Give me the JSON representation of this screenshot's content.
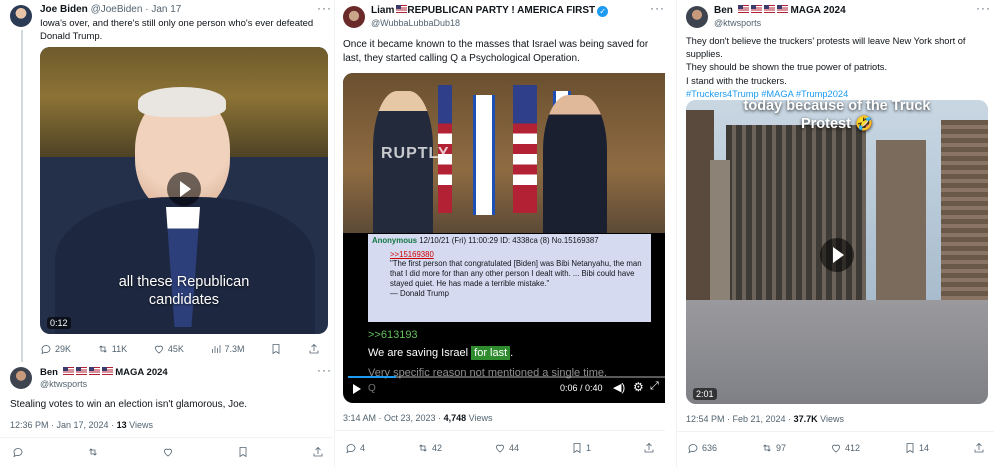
{
  "panel1": {
    "tweet": {
      "name": "Joe Biden",
      "handle": "@JoeBiden",
      "sep": "·",
      "date": "Jan 17",
      "text": "Iowa's over, and there's still only one person who's ever defeated Donald Trump.",
      "video_caption_line1": "all these Republican",
      "video_caption_line2": "candidates",
      "duration": "0:12",
      "stats": {
        "replies": "29K",
        "reposts": "11K",
        "likes": "45K",
        "views": "7.3M"
      }
    },
    "reply": {
      "name": "Ben",
      "handle": "@ktwsports",
      "maga": "MAGA 2024",
      "text": "Stealing votes to win an election isn't glamorous, Joe.",
      "time": "12:36 PM · Jan 17, 2024 ·",
      "views_count": "13",
      "views_label": "Views"
    }
  },
  "panel2": {
    "name": "Liam",
    "name_suffix": "REPUBLICAN PARTY ! AMERICA FIRST",
    "handle": "@WubbaLubbaDub18",
    "text": "Once it became known to the masses that Israel was being saved for last, they started calling Q a Psychological Operation.",
    "watermark": "RUPTLY",
    "post": {
      "author": "Anonymous",
      "date": "12/10/21 (Fri) 11:00:29",
      "id": "ID: 4338ca (8)",
      "no": "No.15169387",
      "quote_link": ">>15169380",
      "quote_text": "\"The first person that congratulated [Biden] was Bibi Netanyahu, the man that I did more for than any other person I dealt with. ... Bibi could have stayed quiet. He has made a terrible mistake.\"",
      "quote_sig": "— Donald Trump"
    },
    "ref": ">>613193",
    "saving_prefix": "We are saving Israel",
    "saving_highlight": "for last",
    "saving_suffix": ".",
    "subline": "Very specific reason not mentioned a single time.",
    "q_mark": "Q",
    "player_time": "0:06 / 0:40",
    "time": "3:14 AM · Oct 23, 2023 ·",
    "views_count": "4,748",
    "views_label": "Views",
    "stats": {
      "replies": "4",
      "reposts": "42",
      "likes": "44",
      "views": "1"
    }
  },
  "panel3": {
    "name": "Ben",
    "maga": "MAGA 2024",
    "handle": "@ktwsports",
    "lines": [
      "They don't believe the truckers' protests will leave New York short of supplies.",
      "They should be shown the true power of patriots.",
      "I stand with the truckers."
    ],
    "hashtags": "#Truckers4Trump #MAGA #Trump2024",
    "video_caption_top": "today because of the Truck",
    "video_caption_bottom": "Protest 🤣",
    "duration": "2:01",
    "time": "12:54 PM · Feb 21, 2024 ·",
    "views_count": "37.7K",
    "views_label": "Views",
    "stats": {
      "replies": "636",
      "reposts": "97",
      "likes": "412",
      "views": "14"
    }
  },
  "colors": {
    "link": "#1d9bf0",
    "muted": "#536471",
    "highlight": "#2e8b2e",
    "anon_green": "#117743",
    "quote_red": "#d00000"
  },
  "icons": [
    "reply-icon",
    "repost-icon",
    "like-icon",
    "views-icon",
    "bookmark-icon",
    "share-icon",
    "play-icon",
    "more-icon",
    "verified-icon"
  ]
}
